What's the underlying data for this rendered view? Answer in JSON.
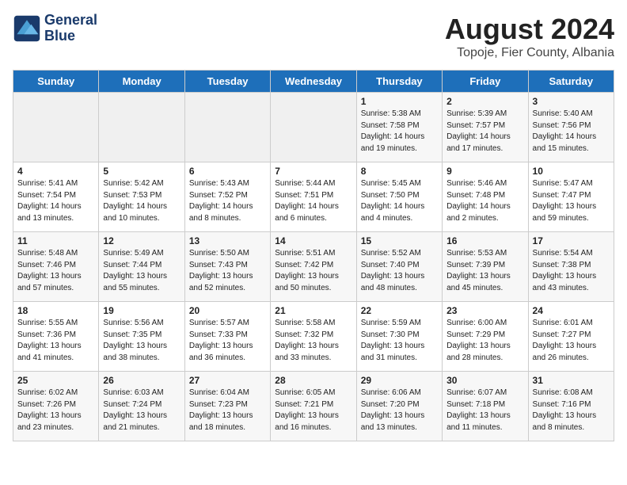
{
  "logo": {
    "line1": "General",
    "line2": "Blue"
  },
  "title": "August 2024",
  "subtitle": "Topoje, Fier County, Albania",
  "weekdays": [
    "Sunday",
    "Monday",
    "Tuesday",
    "Wednesday",
    "Thursday",
    "Friday",
    "Saturday"
  ],
  "weeks": [
    [
      {
        "day": "",
        "detail": ""
      },
      {
        "day": "",
        "detail": ""
      },
      {
        "day": "",
        "detail": ""
      },
      {
        "day": "",
        "detail": ""
      },
      {
        "day": "1",
        "detail": "Sunrise: 5:38 AM\nSunset: 7:58 PM\nDaylight: 14 hours\nand 19 minutes."
      },
      {
        "day": "2",
        "detail": "Sunrise: 5:39 AM\nSunset: 7:57 PM\nDaylight: 14 hours\nand 17 minutes."
      },
      {
        "day": "3",
        "detail": "Sunrise: 5:40 AM\nSunset: 7:56 PM\nDaylight: 14 hours\nand 15 minutes."
      }
    ],
    [
      {
        "day": "4",
        "detail": "Sunrise: 5:41 AM\nSunset: 7:54 PM\nDaylight: 14 hours\nand 13 minutes."
      },
      {
        "day": "5",
        "detail": "Sunrise: 5:42 AM\nSunset: 7:53 PM\nDaylight: 14 hours\nand 10 minutes."
      },
      {
        "day": "6",
        "detail": "Sunrise: 5:43 AM\nSunset: 7:52 PM\nDaylight: 14 hours\nand 8 minutes."
      },
      {
        "day": "7",
        "detail": "Sunrise: 5:44 AM\nSunset: 7:51 PM\nDaylight: 14 hours\nand 6 minutes."
      },
      {
        "day": "8",
        "detail": "Sunrise: 5:45 AM\nSunset: 7:50 PM\nDaylight: 14 hours\nand 4 minutes."
      },
      {
        "day": "9",
        "detail": "Sunrise: 5:46 AM\nSunset: 7:48 PM\nDaylight: 14 hours\nand 2 minutes."
      },
      {
        "day": "10",
        "detail": "Sunrise: 5:47 AM\nSunset: 7:47 PM\nDaylight: 13 hours\nand 59 minutes."
      }
    ],
    [
      {
        "day": "11",
        "detail": "Sunrise: 5:48 AM\nSunset: 7:46 PM\nDaylight: 13 hours\nand 57 minutes."
      },
      {
        "day": "12",
        "detail": "Sunrise: 5:49 AM\nSunset: 7:44 PM\nDaylight: 13 hours\nand 55 minutes."
      },
      {
        "day": "13",
        "detail": "Sunrise: 5:50 AM\nSunset: 7:43 PM\nDaylight: 13 hours\nand 52 minutes."
      },
      {
        "day": "14",
        "detail": "Sunrise: 5:51 AM\nSunset: 7:42 PM\nDaylight: 13 hours\nand 50 minutes."
      },
      {
        "day": "15",
        "detail": "Sunrise: 5:52 AM\nSunset: 7:40 PM\nDaylight: 13 hours\nand 48 minutes."
      },
      {
        "day": "16",
        "detail": "Sunrise: 5:53 AM\nSunset: 7:39 PM\nDaylight: 13 hours\nand 45 minutes."
      },
      {
        "day": "17",
        "detail": "Sunrise: 5:54 AM\nSunset: 7:38 PM\nDaylight: 13 hours\nand 43 minutes."
      }
    ],
    [
      {
        "day": "18",
        "detail": "Sunrise: 5:55 AM\nSunset: 7:36 PM\nDaylight: 13 hours\nand 41 minutes."
      },
      {
        "day": "19",
        "detail": "Sunrise: 5:56 AM\nSunset: 7:35 PM\nDaylight: 13 hours\nand 38 minutes."
      },
      {
        "day": "20",
        "detail": "Sunrise: 5:57 AM\nSunset: 7:33 PM\nDaylight: 13 hours\nand 36 minutes."
      },
      {
        "day": "21",
        "detail": "Sunrise: 5:58 AM\nSunset: 7:32 PM\nDaylight: 13 hours\nand 33 minutes."
      },
      {
        "day": "22",
        "detail": "Sunrise: 5:59 AM\nSunset: 7:30 PM\nDaylight: 13 hours\nand 31 minutes."
      },
      {
        "day": "23",
        "detail": "Sunrise: 6:00 AM\nSunset: 7:29 PM\nDaylight: 13 hours\nand 28 minutes."
      },
      {
        "day": "24",
        "detail": "Sunrise: 6:01 AM\nSunset: 7:27 PM\nDaylight: 13 hours\nand 26 minutes."
      }
    ],
    [
      {
        "day": "25",
        "detail": "Sunrise: 6:02 AM\nSunset: 7:26 PM\nDaylight: 13 hours\nand 23 minutes."
      },
      {
        "day": "26",
        "detail": "Sunrise: 6:03 AM\nSunset: 7:24 PM\nDaylight: 13 hours\nand 21 minutes."
      },
      {
        "day": "27",
        "detail": "Sunrise: 6:04 AM\nSunset: 7:23 PM\nDaylight: 13 hours\nand 18 minutes."
      },
      {
        "day": "28",
        "detail": "Sunrise: 6:05 AM\nSunset: 7:21 PM\nDaylight: 13 hours\nand 16 minutes."
      },
      {
        "day": "29",
        "detail": "Sunrise: 6:06 AM\nSunset: 7:20 PM\nDaylight: 13 hours\nand 13 minutes."
      },
      {
        "day": "30",
        "detail": "Sunrise: 6:07 AM\nSunset: 7:18 PM\nDaylight: 13 hours\nand 11 minutes."
      },
      {
        "day": "31",
        "detail": "Sunrise: 6:08 AM\nSunset: 7:16 PM\nDaylight: 13 hours\nand 8 minutes."
      }
    ]
  ]
}
